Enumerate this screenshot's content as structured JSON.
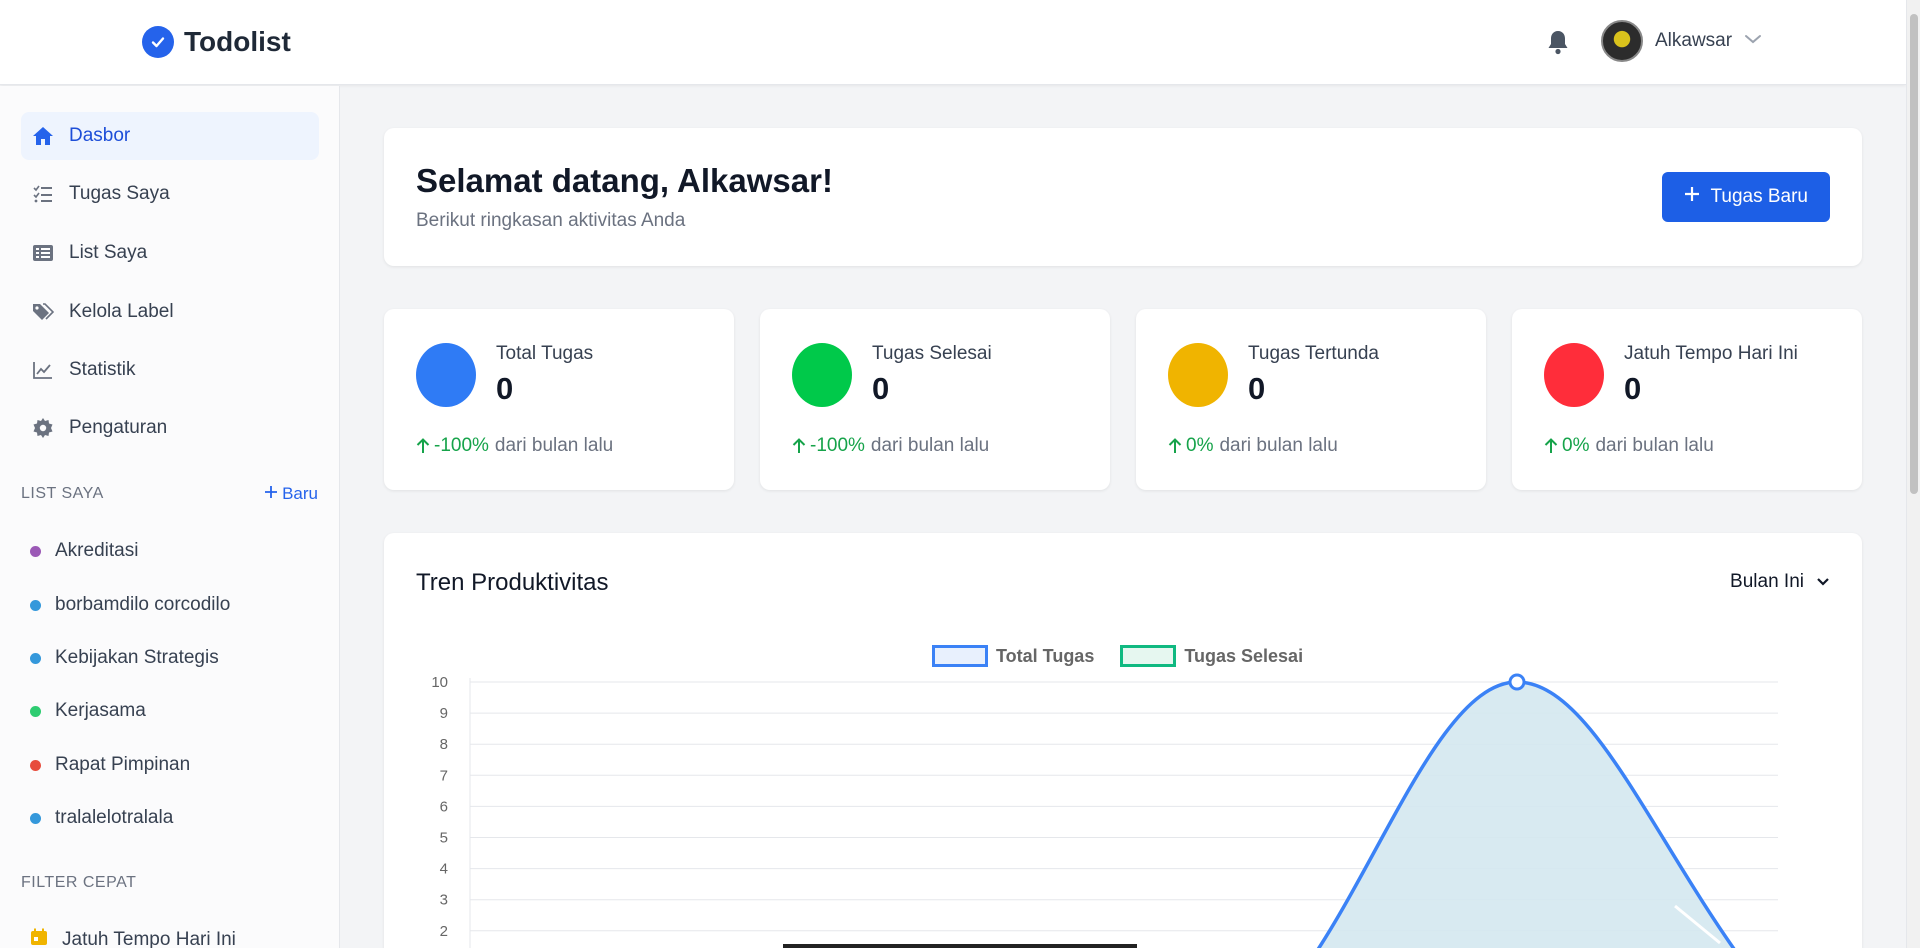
{
  "header": {
    "brand": "Todolist",
    "user_name": "Alkawsar"
  },
  "sidebar": {
    "nav": [
      {
        "label": "Dasbor",
        "icon": "home-icon",
        "active": true
      },
      {
        "label": "Tugas Saya",
        "icon": "tasks-icon",
        "active": false
      },
      {
        "label": "List Saya",
        "icon": "list-icon",
        "active": false
      },
      {
        "label": "Kelola Label",
        "icon": "tags-icon",
        "active": false
      },
      {
        "label": "Statistik",
        "icon": "chart-line-icon",
        "active": false
      },
      {
        "label": "Pengaturan",
        "icon": "gear-icon",
        "active": false
      }
    ],
    "lists_title": "LIST SAYA",
    "lists_new": "Baru",
    "lists": [
      {
        "label": "Akreditasi",
        "color": "#9b59b6"
      },
      {
        "label": "borbamdilo corcodilo",
        "color": "#3498db"
      },
      {
        "label": "Kebijakan Strategis",
        "color": "#3498db"
      },
      {
        "label": "Kerjasama",
        "color": "#2ecc71"
      },
      {
        "label": "Rapat Pimpinan",
        "color": "#e74c3c"
      },
      {
        "label": "tralalelotralala",
        "color": "#3498db"
      }
    ],
    "filter_title": "FILTER CEPAT",
    "filters": [
      {
        "label": "Jatuh Tempo Hari Ini",
        "icon": "calendar-icon",
        "color": "#f0b400"
      }
    ]
  },
  "welcome": {
    "title": "Selamat datang, Alkawsar!",
    "subtitle": "Berikut ringkasan aktivitas Anda",
    "button": "Tugas Baru"
  },
  "stats": [
    {
      "label": "Total Tugas",
      "value": "0",
      "change": "-100%",
      "suffix": "dari bulan lalu",
      "color": "#2f7bf5"
    },
    {
      "label": "Tugas Selesai",
      "value": "0",
      "change": "-100%",
      "suffix": "dari bulan lalu",
      "color": "#00c94a"
    },
    {
      "label": "Tugas Tertunda",
      "value": "0",
      "change": "0%",
      "suffix": "dari bulan lalu",
      "color": "#f0b400"
    },
    {
      "label": "Jatuh Tempo Hari Ini",
      "value": "0",
      "change": "0%",
      "suffix": "dari bulan lalu",
      "color": "#ff2d3a"
    }
  ],
  "trend": {
    "title": "Tren Produktivitas",
    "period": "Bulan Ini"
  },
  "chart_data": {
    "type": "line",
    "title": "",
    "series": [
      {
        "name": "Total Tugas",
        "color": "#3b82f6",
        "fill": "#d4e8f0"
      },
      {
        "name": "Tugas Selesai",
        "color": "#10b981",
        "fill": "#e6f7f0"
      }
    ],
    "y_ticks": [
      "10",
      "9",
      "8",
      "7",
      "6",
      "5",
      "4",
      "3",
      "2"
    ],
    "ylim": [
      0,
      10
    ],
    "peak_value": 10,
    "grid": true,
    "legend": "top-center"
  }
}
